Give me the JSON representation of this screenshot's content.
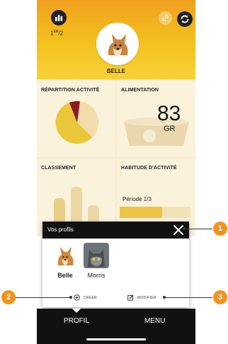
{
  "header": {
    "level": "1",
    "level_sup": "ER",
    "level_total": "/2",
    "pet_name": "BELLE"
  },
  "cards": {
    "activity_title": "RÉPARTITION ACTIVITÉ",
    "food_title": "ALIMENTATION",
    "food_value": "83",
    "food_unit": "GR",
    "ranking_title": "CLASSEMENT",
    "habit_title": "HABITUDE D'ACTIVITÉ",
    "periode": "Période 1/3"
  },
  "modal": {
    "title": "Vos profils",
    "profiles": [
      {
        "name": "Belle",
        "icon": "dog-photo"
      },
      {
        "name": "Morris",
        "icon": "cat-photo"
      }
    ],
    "create_label": "CRÉER",
    "edit_label": "MODIFIER"
  },
  "nav": {
    "profil": "PROFIL",
    "menu": "MENU"
  },
  "callouts": [
    "1",
    "2",
    "3"
  ],
  "colors": {
    "accent": "#f3931f",
    "header_top": "#f0a020",
    "header_bottom": "#f7d13a",
    "pie_yellow": "#e9c63a",
    "pie_red": "#8e1b22",
    "nav_bg": "#111111"
  }
}
